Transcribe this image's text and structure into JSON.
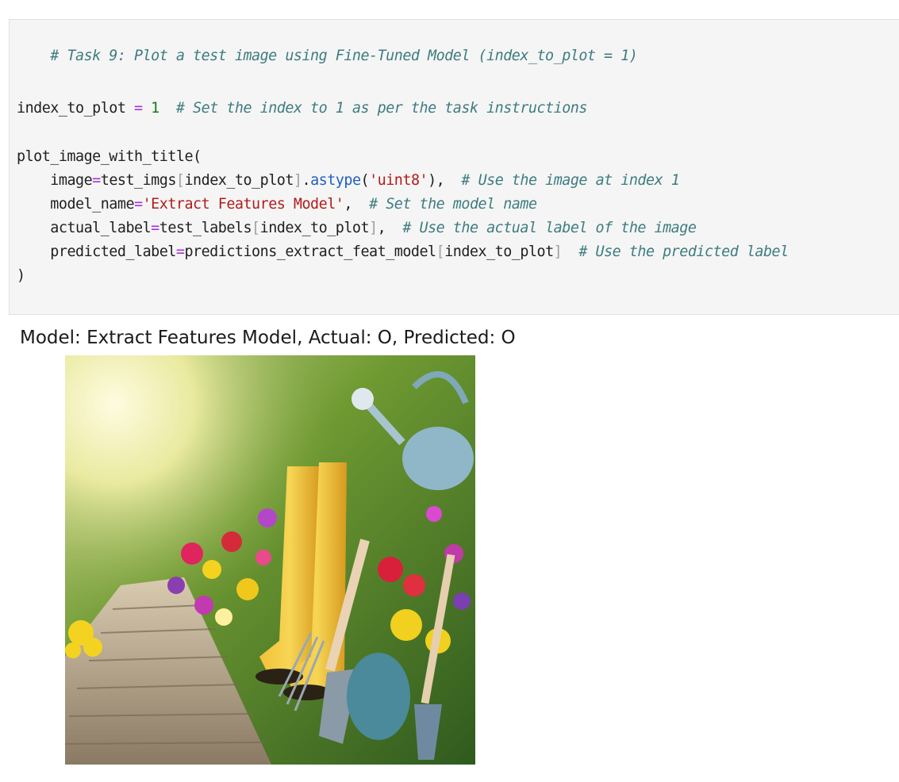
{
  "code": {
    "line1_comment": "# Task 9: Plot a test image using Fine-Tuned Model (index_to_plot = 1)",
    "line2": {
      "var": "index_to_plot ",
      "op": "=",
      "num": "1",
      "comment": "# Set the index to 1 as per the task instructions"
    },
    "line3": {
      "text": "plot_image_with_title("
    },
    "line4": {
      "kw": "image",
      "op": "=",
      "expr": "test_imgs",
      "open": "[",
      "idx": "index_to_plot",
      "close": "]",
      "dot": ".",
      "fn": "astype",
      "paren_open": "(",
      "str": "'uint8'",
      "paren_close": "),",
      "comment": "# Use the image at index 1"
    },
    "line5": {
      "kw": "model_name",
      "op": "=",
      "str": "'Extract Features Model'",
      "comma": ",",
      "comment": "# Set the model name"
    },
    "line6": {
      "kw": "actual_label",
      "op": "=",
      "expr": "test_labels",
      "open": "[",
      "idx": "index_to_plot",
      "close": "]",
      "comma": ",",
      "comment": "# Use the actual label of the image"
    },
    "line7": {
      "kw": "predicted_label",
      "op": "=",
      "expr": "predictions_extract_feat_model",
      "open": "[",
      "idx": "index_to_plot",
      "close": "]",
      "comment": "# Use the predicted label"
    },
    "line8": {
      "text": ")"
    }
  },
  "output": {
    "title": "Model: Extract Features Model, Actual: O, Predicted: O"
  }
}
